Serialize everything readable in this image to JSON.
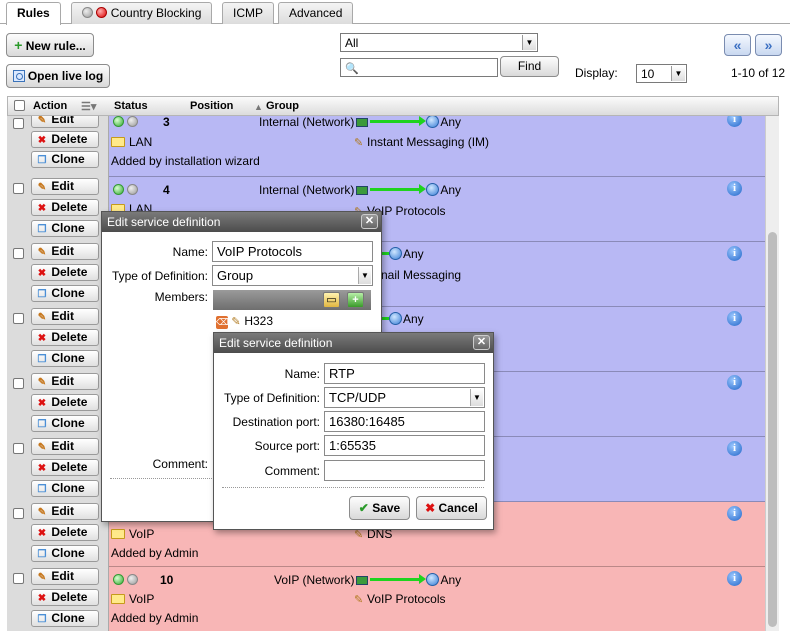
{
  "tabs": [
    {
      "label": "Rules",
      "active": true
    },
    {
      "label": "Country Blocking"
    },
    {
      "label": "ICMP"
    },
    {
      "label": "Advanced"
    }
  ],
  "toolbar": {
    "new_rule": "New rule...",
    "open_live_log": "Open live log",
    "filter_value": "All",
    "search_placeholder": "",
    "find": "Find",
    "display_label": "Display:",
    "display_value": "10",
    "range": "1-10 of 12"
  },
  "table": {
    "headers": {
      "action": "Action",
      "status": "Status",
      "position": "Position",
      "group": "Group"
    },
    "row_buttons": {
      "edit": "Edit",
      "delete": "Delete",
      "clone": "Clone"
    },
    "rows": [
      {
        "pos": "3",
        "source": "Internal (Network)",
        "dest": "Any",
        "group": "LAN",
        "service": "Instant Messaging (IM)",
        "comment": "Added by installation wizard"
      },
      {
        "pos": "4",
        "source": "Internal (Network)",
        "dest": "Any",
        "group": "LAN",
        "service": "VoIP Protocols",
        "comment": ""
      },
      {
        "pos": "",
        "source": "",
        "dest": "Any",
        "group": "",
        "service": "nail Messaging",
        "comment": ""
      },
      {
        "pos": "",
        "source": "",
        "dest": "Any",
        "group": "",
        "service": "",
        "comment": ""
      },
      {
        "pos": "",
        "source": "",
        "dest": "",
        "group": "",
        "service": "",
        "comment": ""
      },
      {
        "pos": "",
        "source": "",
        "dest": "",
        "group": "",
        "service": "",
        "comment": ""
      },
      {
        "pos": "",
        "source": "",
        "dest": "",
        "group": "VoIP",
        "service": "DNS",
        "comment": "Added by Admin"
      },
      {
        "pos": "10",
        "source": "VoIP (Network)",
        "dest": "Any",
        "group": "VoIP",
        "service": "VoIP Protocols",
        "comment": "Added by Admin"
      }
    ]
  },
  "dialog1": {
    "title": "Edit service definition",
    "name_label": "Name:",
    "name_value": "VoIP Protocols",
    "type_label": "Type of Definition:",
    "type_value": "Group",
    "members_label": "Members:",
    "member1": "H323",
    "comment_label": "Comment:"
  },
  "dialog2": {
    "title": "Edit service definition",
    "name_label": "Name:",
    "name_value": "RTP",
    "type_label": "Type of Definition:",
    "type_value": "TCP/UDP",
    "dest_port_label": "Destination port:",
    "dest_port_value": "16380:16485",
    "source_port_label": "Source port:",
    "source_port_value": "1:65535",
    "comment_label": "Comment:",
    "comment_value": "",
    "save": "Save",
    "cancel": "Cancel"
  }
}
